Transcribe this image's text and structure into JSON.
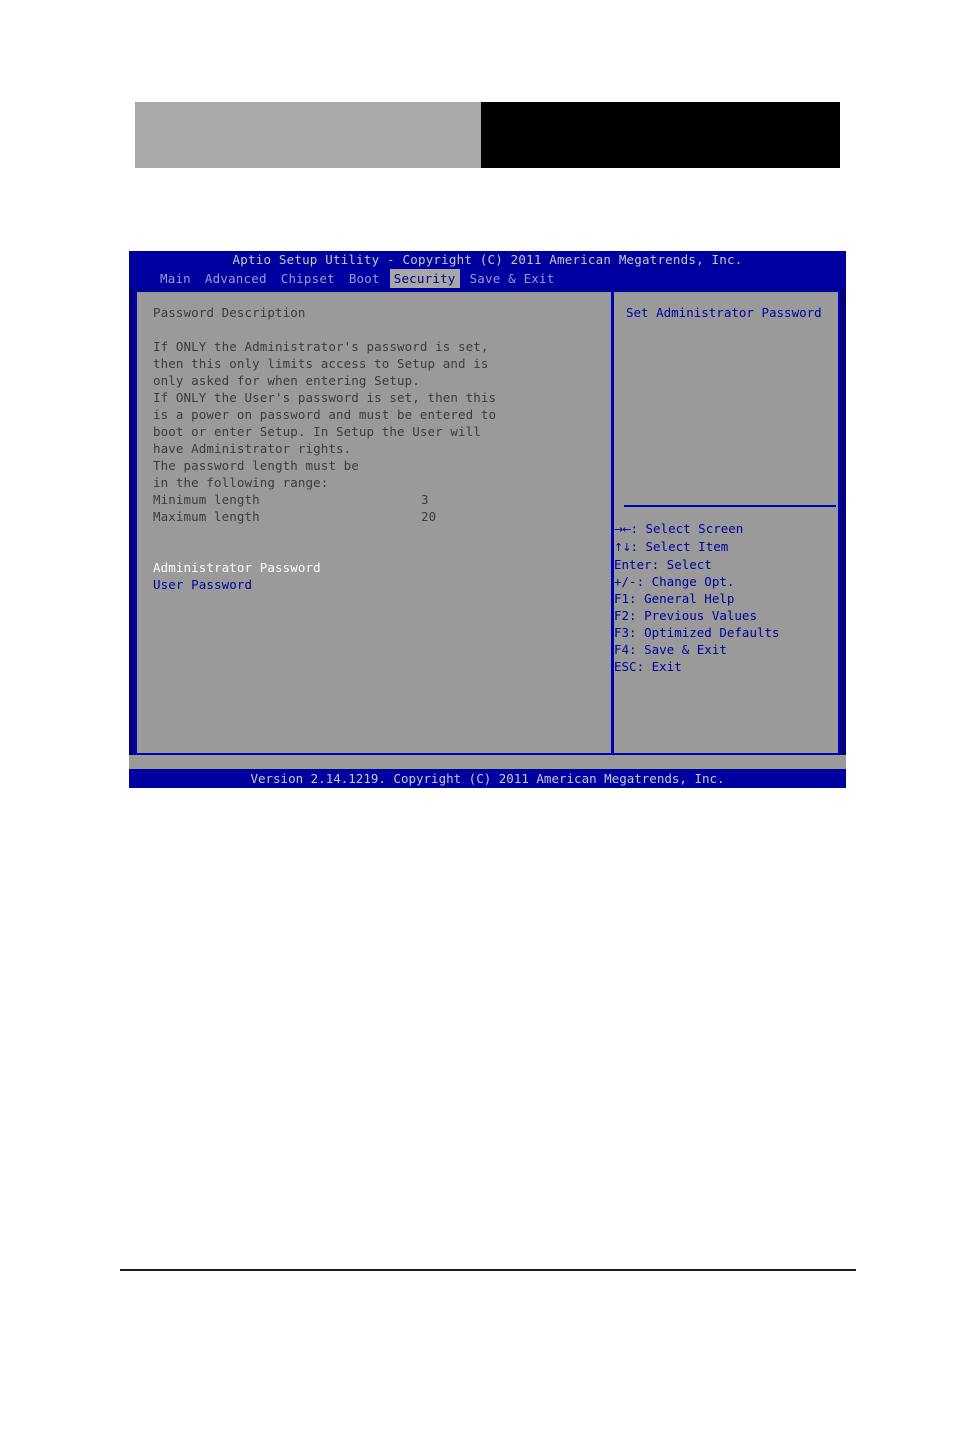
{
  "page": {
    "top_blocks": [
      {
        "name": "gray-block",
        "color": "#a8a8a8"
      },
      {
        "name": "black-block",
        "color": "#000000"
      }
    ]
  },
  "bios": {
    "title": "Aptio Setup Utility - Copyright (C) 2011 American Megatrends, Inc.",
    "footer": "Version 2.14.1219. Copyright (C) 2011 American Megatrends, Inc.",
    "menu_tabs": [
      {
        "label": "Main",
        "active": false
      },
      {
        "label": "Advanced",
        "active": false
      },
      {
        "label": "Chipset",
        "active": false
      },
      {
        "label": "Boot",
        "active": false
      },
      {
        "label": "Security",
        "active": true
      },
      {
        "label": "Save & Exit",
        "active": false
      }
    ],
    "left_panel": {
      "section_title": "Password Description",
      "description_lines": [
        "If ONLY the Administrator's password is set,",
        "then this only limits access to Setup and is",
        "only asked for when entering Setup.",
        "If ONLY the User's password is set, then this",
        "is a power on password and must be entered to",
        "boot or enter Setup. In Setup the User will",
        "have Administrator rights.",
        "The password length must be",
        "in the following range:"
      ],
      "length_rows": [
        {
          "label": "Minimum length",
          "value": "3"
        },
        {
          "label": "Maximum length",
          "value": "20"
        }
      ],
      "items": [
        {
          "label": "Administrator Password",
          "selected": true
        },
        {
          "label": "User Password",
          "selected": false
        }
      ]
    },
    "right_panel": {
      "help_text": "Set Administrator Password",
      "key_legend": [
        {
          "glyph": "→←",
          "text": ": Select Screen"
        },
        {
          "glyph": "↑↓",
          "text": ": Select Item"
        },
        {
          "glyph": "",
          "text": "Enter: Select"
        },
        {
          "glyph": "",
          "text": "+/-: Change Opt."
        },
        {
          "glyph": "",
          "text": "F1: General Help"
        },
        {
          "glyph": "",
          "text": "F2: Previous Values"
        },
        {
          "glyph": "",
          "text": "F3: Optimized Defaults"
        },
        {
          "glyph": "",
          "text": "F4: Save & Exit"
        },
        {
          "glyph": "",
          "text": "ESC: Exit"
        }
      ]
    },
    "colors": {
      "title_bar": "#0000a0",
      "panel_bg": "#9a9a9a",
      "frame": "#0000b4",
      "accent_text": "#00009e",
      "selected_text": "#ffffff"
    }
  }
}
